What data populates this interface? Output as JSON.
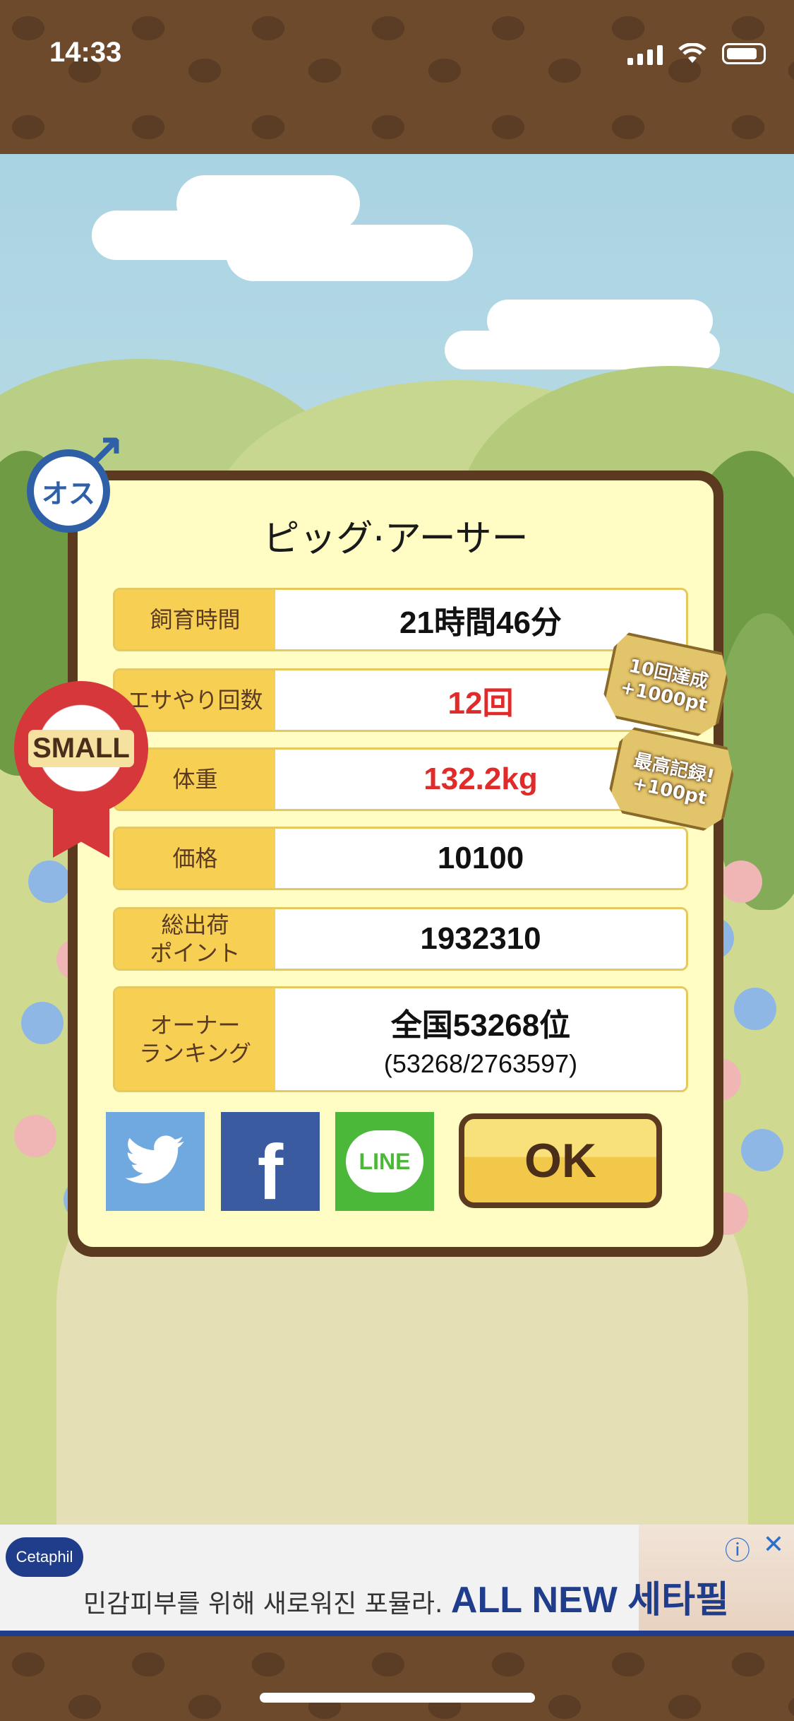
{
  "status_bar": {
    "time": "14:33"
  },
  "badges": {
    "gender_label": "オス",
    "size_label": "SMALL"
  },
  "dialog": {
    "title": "ピッグ·アーサー",
    "rows": [
      {
        "label": "飼育時間",
        "value": "21時間46分",
        "highlight": false
      },
      {
        "label": "エサやり回数",
        "value": "12回",
        "highlight": true
      },
      {
        "label": "体重",
        "value": "132.2kg",
        "highlight": true
      },
      {
        "label": "価格",
        "value": "10100",
        "highlight": false
      },
      {
        "label": "総出荷\nポイント",
        "value": "1932310",
        "highlight": false
      },
      {
        "label": "オーナー\nランキング",
        "value": "全国53268位",
        "subvalue": "(53268/2763597)",
        "highlight": false
      }
    ],
    "share": {
      "twitter_icon": "twitter-icon",
      "facebook_label": "f",
      "line_label": "LINE"
    },
    "ok_label": "OK"
  },
  "bonuses": [
    {
      "line1": "10回達成",
      "line2": "+1000pt"
    },
    {
      "line1": "最高記録!",
      "line2": "+100pt"
    }
  ],
  "ad": {
    "brand": "Cetaphil",
    "text": "민감피부를 위해 새로워진 포뮬라.",
    "headline": "ALL NEW 세타필",
    "info_icon": "ⓘ",
    "close_icon": "✕"
  },
  "colors": {
    "accent_red": "#e02b2b",
    "label_yellow": "#f6cf53",
    "frame_brown": "#5b3a1f"
  }
}
